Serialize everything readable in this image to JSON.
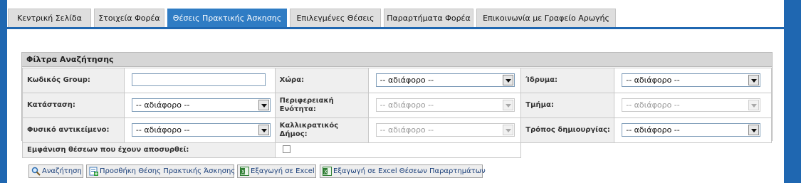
{
  "tabs": [
    {
      "label": "Κεντρική Σελίδα",
      "active": false
    },
    {
      "label": "Στοιχεία Φορέα",
      "active": false
    },
    {
      "label": "Θέσεις Πρακτικής Άσκησης",
      "active": true
    },
    {
      "label": "Επιλεγμένες Θέσεις",
      "active": false
    },
    {
      "label": "Παραρτήματα Φορέα",
      "active": false
    },
    {
      "label": "Επικοινωνία με Γραφείο Αρωγής",
      "active": false
    }
  ],
  "filters": {
    "title": "Φίλτρα Αναζήτησης",
    "group_code_label": "Κωδικός Group:",
    "group_code_value": "",
    "country_label": "Χώρα:",
    "country_value": "-- αδιάφορο --",
    "institution_label": "Ίδρυμα:",
    "institution_value": "-- αδιάφορο --",
    "status_label": "Κατάσταση:",
    "status_value": "-- αδιάφορο --",
    "region_label": "Περιφερειακή Ενότητα:",
    "region_value": "-- αδιάφορο --",
    "department_label": "Τμήμα:",
    "department_value": "-- αδιάφορο --",
    "physical_object_label": "Φυσικό αντικείμενο:",
    "physical_object_value": "-- αδιάφορο --",
    "municipality_label": "Καλλικρατικός Δήμος:",
    "municipality_value": "-- αδιάφορο --",
    "creation_method_label": "Τρόπος δημιουργίας:",
    "creation_method_value": "-- αδιάφορο --",
    "show_withdrawn_label": "Εμφάνιση θέσεων που έχουν αποσυρθεί:"
  },
  "buttons": {
    "search": "Αναζήτηση",
    "add_position": "Προσθήκη Θέσης Πρακτικής Άσκησης",
    "export_excel": "Εξαγωγή σε Excel",
    "export_excel_branches": "Εξαγωγή σε Excel Θέσεων Παραρτημάτων"
  },
  "colors": {
    "frame": "#1f67b1",
    "active_tab": "#2f7cc4"
  }
}
